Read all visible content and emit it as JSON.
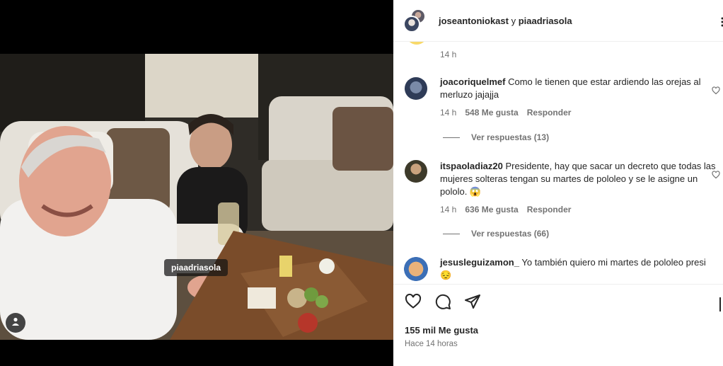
{
  "post": {
    "tag_label": "piaadriasola"
  },
  "header": {
    "author1": "joseantoniokast",
    "joiner": " y ",
    "author2": "piaadriasola"
  },
  "comments": {
    "prev_time": "14 h",
    "items": [
      {
        "username": "joacoriquelmef",
        "text": "Como le tienen que estar ardiendo las orejas al merluzo jajajja",
        "time": "14 h",
        "likes": "548 Me gusta",
        "reply": "Responder",
        "view_replies": "Ver respuestas (13)"
      },
      {
        "username": "itspaoladiaz20",
        "text": "Presidente, hay que sacar un decreto que todas las mujeres solteras tengan su martes de pololeo y se le asigne un pololo. 😱",
        "time": "14 h",
        "likes": "636 Me gusta",
        "reply": "Responder",
        "view_replies": "Ver respuestas (66)"
      },
      {
        "username": "jesusleguizamon_",
        "text": "Yo también quiero mi martes de pololeo presi 😔"
      }
    ]
  },
  "footer": {
    "likes": "155 mil Me gusta",
    "ago": "Hace 14 horas"
  },
  "icons": [
    "user-tag-icon",
    "heart-icon",
    "comment-icon",
    "share-icon",
    "more-icon",
    "bookmark-icon"
  ]
}
